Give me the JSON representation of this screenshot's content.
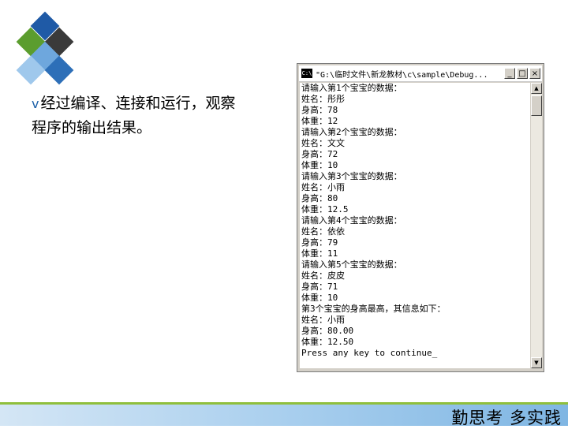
{
  "slide": {
    "bullet": "v",
    "text_line1": "经过编译、连接和运行，观察",
    "text_line2": "程序的输出结果。"
  },
  "window": {
    "icon_label": "C:\\",
    "title": "\"G:\\临时文件\\新龙教材\\c\\sample\\Debug...",
    "min_label": "_",
    "max_label": "□",
    "close_label": "×"
  },
  "console": {
    "lines": [
      "请输入第1个宝宝的数据：",
      "姓名：彤彤",
      "身高：78",
      "体重：12",
      "请输入第2个宝宝的数据：",
      "姓名：文文",
      "身高：72",
      "体重：10",
      "请输入第3个宝宝的数据：",
      "姓名：小雨",
      "身高：80",
      "体重：12.5",
      "请输入第4个宝宝的数据：",
      "姓名：依依",
      "身高：79",
      "体重：11",
      "请输入第5个宝宝的数据：",
      "姓名：皮皮",
      "身高：71",
      "体重：10",
      "第3个宝宝的身高最高，其信息如下：",
      "姓名：小雨",
      "身高：80.00",
      "体重：12.50",
      "Press any key to continue_"
    ]
  },
  "scrollbar": {
    "up_arrow": "▲",
    "down_arrow": "▼"
  },
  "footer": {
    "motto": "勤思考 多实践"
  },
  "colors": {
    "accent_green": "#8fbf3c",
    "bar_blue": "#7fb6e3",
    "bullet_blue": "#1a5fa8"
  }
}
